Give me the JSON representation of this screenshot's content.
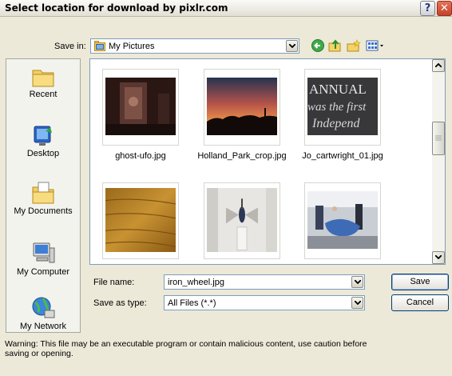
{
  "window": {
    "title": "Select location for download by pixlr.com",
    "help_label": "?",
    "close_label": "✕"
  },
  "save_in": {
    "label": "Save in:",
    "value": "My Pictures"
  },
  "toolbar": {
    "back_icon": "back-arrow-icon",
    "up_icon": "up-folder-icon",
    "new_folder_icon": "new-folder-icon",
    "views_icon": "views-menu-icon"
  },
  "places": [
    {
      "label": "Recent",
      "icon": "recent-folder-icon"
    },
    {
      "label": "Desktop",
      "icon": "desktop-icon"
    },
    {
      "label": "My Documents",
      "icon": "my-documents-icon"
    },
    {
      "label": "My Computer",
      "icon": "my-computer-icon"
    },
    {
      "label": "My Network",
      "icon": "my-network-icon"
    }
  ],
  "files": [
    {
      "name": "ghost-ufo.jpg"
    },
    {
      "name": "Holland_Park_crop.jpg"
    },
    {
      "name": "Jo_cartwright_01.jpg"
    },
    {
      "name": ""
    },
    {
      "name": ""
    },
    {
      "name": ""
    }
  ],
  "thumb_text": {
    "line1": "ANNUAL",
    "line2": "was the first",
    "line3": "Independ"
  },
  "file_name": {
    "label": "File name:",
    "value": "iron_wheel.jpg"
  },
  "save_as_type": {
    "label": "Save as type:",
    "value": "All Files (*.*)"
  },
  "buttons": {
    "save": "Save",
    "cancel": "Cancel"
  },
  "warning": "Warning: This file may be an executable program or contain malicious content, use caution before saving or opening."
}
